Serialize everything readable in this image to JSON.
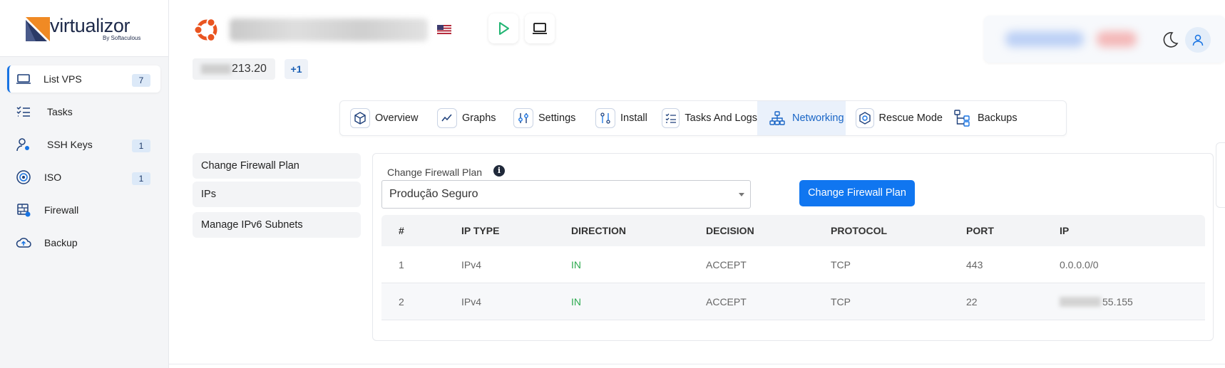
{
  "brand": {
    "name": "virtualizor",
    "by": "By Softaculous"
  },
  "sidebar": {
    "items": [
      {
        "label": "List VPS",
        "count": "7",
        "icon": "laptop-icon",
        "active": true
      },
      {
        "label": "Tasks",
        "count": "",
        "icon": "tasks-icon",
        "active": false
      },
      {
        "label": "SSH Keys",
        "count": "1",
        "icon": "ssh-key-icon",
        "active": false
      },
      {
        "label": "ISO",
        "count": "1",
        "icon": "disc-icon",
        "active": false
      },
      {
        "label": "Firewall",
        "count": "",
        "icon": "firewall-icon",
        "active": false
      },
      {
        "label": "Backup",
        "count": "",
        "icon": "cloud-upload-icon",
        "active": false
      }
    ]
  },
  "header": {
    "os_icon": "ubuntu-icon",
    "flag": "us-flag-icon",
    "ip_visible_suffix": "213.20",
    "extra_ips": "+1"
  },
  "tabs": [
    {
      "label": "Overview",
      "icon": "cube-icon"
    },
    {
      "label": "Graphs",
      "icon": "graph-icon"
    },
    {
      "label": "Settings",
      "icon": "sliders-icon"
    },
    {
      "label": "Install",
      "icon": "install-icon"
    },
    {
      "label": "Tasks And Logs",
      "icon": "checklist-icon"
    },
    {
      "label": "Networking",
      "icon": "network-icon",
      "active": true
    },
    {
      "label": "Rescue Mode",
      "icon": "rescue-icon"
    },
    {
      "label": "Backups",
      "icon": "backups-icon"
    }
  ],
  "subnav": [
    "Change Firewall Plan",
    "IPs",
    "Manage IPv6 Subnets"
  ],
  "firewall": {
    "label": "Change Firewall Plan",
    "selected_plan": "Produção Seguro",
    "button_label": "Change Firewall Plan"
  },
  "table": {
    "headers": [
      "#",
      "IP TYPE",
      "DIRECTION",
      "DECISION",
      "PROTOCOL",
      "PORT",
      "IP"
    ],
    "rows": [
      [
        "1",
        "IPv4",
        "IN",
        "ACCEPT",
        "TCP",
        "443",
        "0.0.0.0/0"
      ],
      [
        "2",
        "IPv4",
        "IN",
        "ACCEPT",
        "TCP",
        "22",
        "55.155"
      ]
    ]
  },
  "colors": {
    "accent": "#1076f0",
    "active_tab_text": "#1a66c6",
    "direction_in": "#2daa4f",
    "logo_orange": "#f08a24",
    "logo_navy": "#2b3a67"
  }
}
